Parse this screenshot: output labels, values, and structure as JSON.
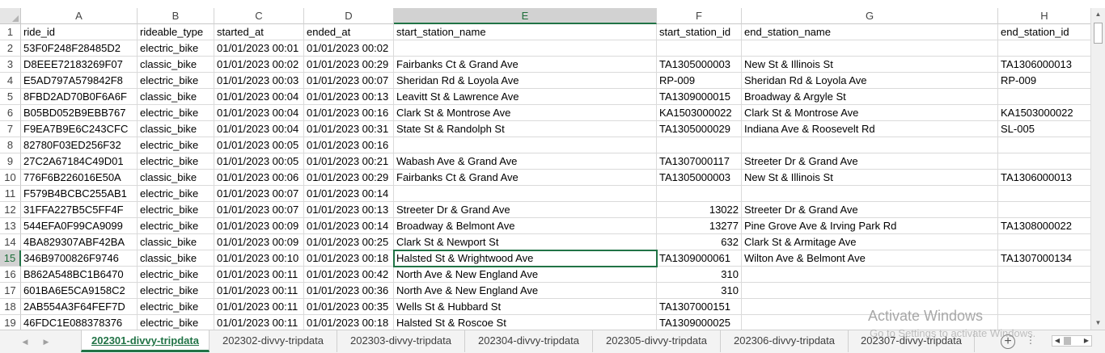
{
  "columns": [
    "A",
    "B",
    "C",
    "D",
    "E",
    "F",
    "G",
    "H"
  ],
  "selected_column": "E",
  "selected_row": "15",
  "rows": [
    {
      "n": "1",
      "c": [
        "ride_id",
        "rideable_type",
        "started_at",
        "ended_at",
        "start_station_name",
        "start_station_id",
        "end_station_name",
        "end_station_id"
      ]
    },
    {
      "n": "2",
      "c": [
        "53F0F248F28485D2",
        "electric_bike",
        "01/01/2023 00:01",
        "01/01/2023 00:02",
        "",
        "",
        "",
        ""
      ]
    },
    {
      "n": "3",
      "c": [
        "D8EEE72183269F07",
        "classic_bike",
        "01/01/2023 00:02",
        "01/01/2023 00:29",
        "Fairbanks Ct & Grand Ave",
        "TA1305000003",
        "New St & Illinois St",
        "TA1306000013"
      ]
    },
    {
      "n": "4",
      "c": [
        "E5AD797A579842F8",
        "electric_bike",
        "01/01/2023 00:03",
        "01/01/2023 00:07",
        "Sheridan Rd & Loyola Ave",
        "RP-009",
        "Sheridan Rd & Loyola Ave",
        "RP-009"
      ]
    },
    {
      "n": "5",
      "c": [
        "8FBD2AD70B0F6A6F",
        "classic_bike",
        "01/01/2023 00:04",
        "01/01/2023 00:13",
        "Leavitt St & Lawrence Ave",
        "TA1309000015",
        "Broadway & Argyle St",
        ""
      ]
    },
    {
      "n": "6",
      "c": [
        "B05BD052B9EBB767",
        "electric_bike",
        "01/01/2023 00:04",
        "01/01/2023 00:16",
        "Clark St & Montrose Ave",
        "KA1503000022",
        "Clark St & Montrose Ave",
        "KA1503000022"
      ]
    },
    {
      "n": "7",
      "c": [
        "F9EA7B9E6C243CFC",
        "classic_bike",
        "01/01/2023 00:04",
        "01/01/2023 00:31",
        "State St & Randolph St",
        "TA1305000029",
        "Indiana Ave & Roosevelt Rd",
        "SL-005"
      ]
    },
    {
      "n": "8",
      "c": [
        "82780F03ED256F32",
        "electric_bike",
        "01/01/2023 00:05",
        "01/01/2023 00:16",
        "",
        "",
        "",
        ""
      ]
    },
    {
      "n": "9",
      "c": [
        "27C2A67184C49D01",
        "electric_bike",
        "01/01/2023 00:05",
        "01/01/2023 00:21",
        "Wabash Ave & Grand Ave",
        "TA1307000117",
        "Streeter Dr & Grand Ave",
        ""
      ]
    },
    {
      "n": "10",
      "c": [
        "776F6B226016E50A",
        "classic_bike",
        "01/01/2023 00:06",
        "01/01/2023 00:29",
        "Fairbanks Ct & Grand Ave",
        "TA1305000003",
        "New St & Illinois St",
        "TA1306000013"
      ]
    },
    {
      "n": "11",
      "c": [
        "F579B4BCBC255AB1",
        "electric_bike",
        "01/01/2023 00:07",
        "01/01/2023 00:14",
        "",
        "",
        "",
        ""
      ]
    },
    {
      "n": "12",
      "c": [
        "31FFA227B5C5FF4F",
        "electric_bike",
        "01/01/2023 00:07",
        "01/01/2023 00:13",
        "Streeter Dr & Grand Ave",
        "13022",
        "Streeter Dr & Grand Ave",
        ""
      ]
    },
    {
      "n": "13",
      "c": [
        "544EFA0F99CA9099",
        "electric_bike",
        "01/01/2023 00:09",
        "01/01/2023 00:14",
        "Broadway & Belmont Ave",
        "13277",
        "Pine Grove Ave & Irving Park Rd",
        "TA1308000022"
      ]
    },
    {
      "n": "14",
      "c": [
        "4BA829307ABF42BA",
        "classic_bike",
        "01/01/2023 00:09",
        "01/01/2023 00:25",
        "Clark St & Newport St",
        "632",
        "Clark St & Armitage Ave",
        ""
      ]
    },
    {
      "n": "15",
      "c": [
        "346B9700826F9746",
        "classic_bike",
        "01/01/2023 00:10",
        "01/01/2023 00:18",
        "Halsted St & Wrightwood Ave",
        "TA1309000061",
        "Wilton Ave & Belmont Ave",
        "TA1307000134"
      ]
    },
    {
      "n": "16",
      "c": [
        "B862A548BC1B6470",
        "electric_bike",
        "01/01/2023 00:11",
        "01/01/2023 00:42",
        "North Ave & New England Ave",
        "310",
        "",
        ""
      ]
    },
    {
      "n": "17",
      "c": [
        "601BA6E5CA9158C2",
        "electric_bike",
        "01/01/2023 00:11",
        "01/01/2023 00:36",
        "North Ave & New England Ave",
        "310",
        "",
        ""
      ]
    },
    {
      "n": "18",
      "c": [
        "2AB554A3F64FEF7D",
        "electric_bike",
        "01/01/2023 00:11",
        "01/01/2023 00:35",
        "Wells St & Hubbard St",
        "TA1307000151",
        "",
        ""
      ]
    },
    {
      "n": "19",
      "c": [
        "46FDC1E088378376",
        "electric_bike",
        "01/01/2023 00:11",
        "01/01/2023 00:18",
        "Halsted St & Roscoe St",
        "TA1309000025",
        "",
        ""
      ]
    }
  ],
  "sheet_tabs": [
    "202301-divvy-tripdata",
    "202302-divvy-tripdata",
    "202303-divvy-tripdata",
    "202304-divvy-tripdata",
    "202305-divvy-tripdata",
    "202306-divvy-tripdata",
    "202307-divvy-tripdata"
  ],
  "active_tab": "202301-divvy-tripdata",
  "add_sheet_label": "+",
  "tabs_menu_label": "⋮",
  "watermark": {
    "title": "Activate Windows",
    "subtitle": "Go to Settings to activate Windows."
  },
  "accent_color": "#217346"
}
